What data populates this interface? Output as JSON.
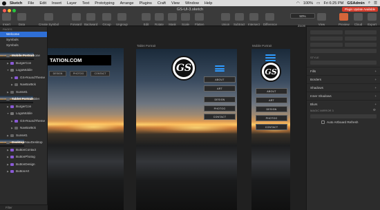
{
  "menubar": {
    "app_name": "Sketch",
    "items": [
      "File",
      "Edit",
      "Insert",
      "Layer",
      "Text",
      "Prototyping",
      "Arrange",
      "Plugins",
      "Craft",
      "View",
      "Window",
      "Help"
    ],
    "battery": "100%",
    "time": "Fri 6:25 PM",
    "user": "GSAdmin"
  },
  "toolbar": {
    "doc_title": "GS-UI-3.sketch",
    "insert": "Insert",
    "data": "Data",
    "create_symbol": "Create Symbol",
    "forward": "Forward",
    "backward": "Backward",
    "group": "Group",
    "ungroup": "Ungroup",
    "edit": "Edit",
    "rotate": "Rotate",
    "mask": "Mask",
    "scale": "Scale",
    "flatten": "Flatten",
    "union": "Union",
    "subtract": "Subtract",
    "intersect": "Intersect",
    "difference": "Difference",
    "zoom": "Zoom",
    "zoom_value": "50%",
    "view": "View",
    "preview": "Preview",
    "cloud": "Cloud",
    "export": "Export",
    "upgrade": "Plugin Update Available"
  },
  "layers": {
    "pages_header": "PAGES",
    "pages": [
      "Welcome",
      "Symbols",
      "Symbols"
    ],
    "rows": [
      {
        "label": "Mobile Portrait",
        "artboard": true,
        "indent": 0
      },
      {
        "label": "MobileNavPhone",
        "artboard": false,
        "indent": 1,
        "kind": "sym"
      },
      {
        "label": "BurgerCon",
        "artboard": false,
        "indent": 1,
        "kind": "sym"
      },
      {
        "label": "LogoMobile",
        "artboard": false,
        "indent": 1,
        "kind": "fold"
      },
      {
        "label": "GS-RoundTheme",
        "artboard": false,
        "indent": 2,
        "kind": "sym"
      },
      {
        "label": "NavBarBck",
        "artboard": false,
        "indent": 2,
        "kind": "plain"
      },
      {
        "label": "Sunset1",
        "artboard": false,
        "indent": 1,
        "kind": "plain"
      },
      {
        "label": "Tablet Portrait",
        "artboard": true,
        "indent": 0
      },
      {
        "label": "MobileNavTablet",
        "artboard": false,
        "indent": 1,
        "kind": "sym"
      },
      {
        "label": "BurgerCon",
        "artboard": false,
        "indent": 1,
        "kind": "sym"
      },
      {
        "label": "LogoMobile",
        "artboard": false,
        "indent": 1,
        "kind": "fold"
      },
      {
        "label": "GS-RoundTheme",
        "artboard": false,
        "indent": 2,
        "kind": "sym"
      },
      {
        "label": "NavBarBck",
        "artboard": false,
        "indent": 2,
        "kind": "plain"
      },
      {
        "label": "Sunset1",
        "artboard": false,
        "indent": 1,
        "kind": "plain"
      },
      {
        "label": "Desktop",
        "artboard": true,
        "indent": 0
      },
      {
        "label": "MobileNavDesktop",
        "artboard": false,
        "indent": 1,
        "kind": "sym"
      },
      {
        "label": "ButtonContact",
        "artboard": false,
        "indent": 1,
        "kind": "sym"
      },
      {
        "label": "ButtonPhotog",
        "artboard": false,
        "indent": 1,
        "kind": "sym"
      },
      {
        "label": "ButtonDesign",
        "artboard": false,
        "indent": 1,
        "kind": "sym"
      },
      {
        "label": "ButtonArt",
        "artboard": false,
        "indent": 1,
        "kind": "sym"
      }
    ],
    "filter": "Filter"
  },
  "canvas": {
    "tablet_label": "Tablet Portrait",
    "mobile_label": "Mobile Portrait",
    "desktop_banner": "TATION.COM",
    "desktop_nav": [
      "DESIGN",
      "PHOTOG",
      "CONTACT"
    ],
    "logo_text": "GS",
    "nav_items": [
      "ABOUT",
      "ART",
      "DESIGN",
      "PHOTOG",
      "CONTACT"
    ]
  },
  "inspector": {
    "style": "STYLE",
    "fills": "Fills",
    "borders": "Borders",
    "shadows": "Shadows",
    "inner_shadows": "Inner Shadows",
    "blurs": "Blurs",
    "magic_mirror": "MAGIC MIRROR 3",
    "auto_refresh": "Auto Artboard Refresh"
  }
}
